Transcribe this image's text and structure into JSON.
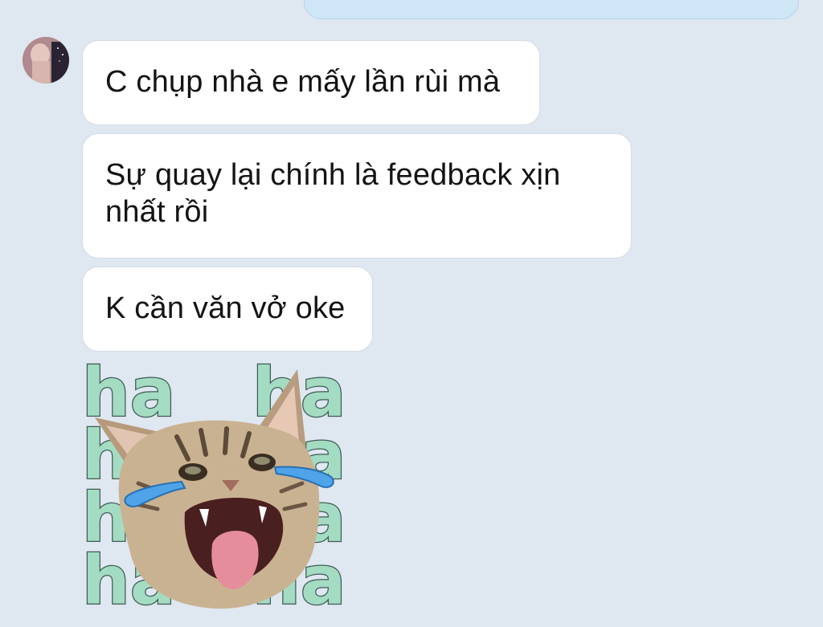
{
  "chat": {
    "messages": [
      {
        "sender": "incoming",
        "text": "C chụp nhà e mấy lần rùi mà"
      },
      {
        "sender": "incoming",
        "text": "Sự quay lại chính là feedback xịn nhất rồi"
      },
      {
        "sender": "incoming",
        "text": "K cần văn vở oke"
      }
    ],
    "sticker": {
      "name": "laughing-cat-sticker",
      "words": [
        "ha",
        "ha",
        "ha",
        "ha",
        "ha",
        "ha",
        "ha",
        "ha"
      ]
    }
  },
  "colors": {
    "background": "#dfe7f1",
    "incoming_bubble": "#ffffff",
    "outgoing_bubble": "#cfe6f6",
    "sticker_text": "#a3dcc2"
  }
}
